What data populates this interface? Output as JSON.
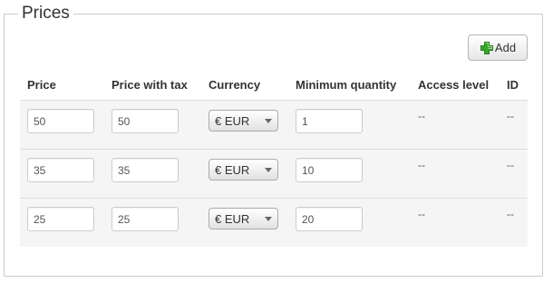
{
  "section": {
    "legend": "Prices",
    "add_label": "Add"
  },
  "columns": [
    "Price",
    "Price with tax",
    "Currency",
    "Minimum quantity",
    "Access level",
    "ID"
  ],
  "rows": [
    {
      "price": "50",
      "price_with_tax": "50",
      "currency": "€ EUR",
      "min_qty": "1",
      "access": "--",
      "id": "--"
    },
    {
      "price": "35",
      "price_with_tax": "35",
      "currency": "€ EUR",
      "min_qty": "10",
      "access": "--",
      "id": "--"
    },
    {
      "price": "25",
      "price_with_tax": "25",
      "currency": "€ EUR",
      "min_qty": "20",
      "access": "--",
      "id": "--"
    }
  ],
  "colors": {
    "add_icon_green": "#3aa52c"
  }
}
